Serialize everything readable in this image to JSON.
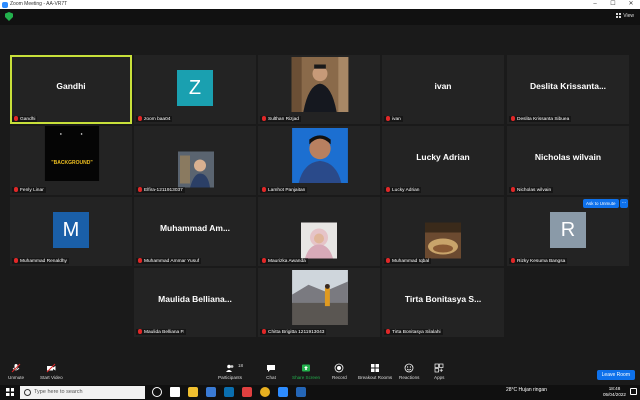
{
  "window": {
    "title": "Zoom Meeting - AA-VR7T",
    "minimize": "–",
    "maximize": "☐",
    "close": "✕"
  },
  "topbar": {
    "view_label": "View"
  },
  "tiles": [
    {
      "big_name": "Gandhi",
      "label": "Gandhi"
    },
    {
      "letter": "Z",
      "color": "#1aa0b0",
      "label": "zoom baa04"
    },
    {
      "label": "Sulthan Rizjad"
    },
    {
      "big_name": "ivan",
      "label": "ivan"
    },
    {
      "big_name": "Deslita Krissanta...",
      "label": "Deslita Krissanta Sibuea"
    },
    {
      "label": "Fenly Linar",
      "poster_text": "\"BACKGROUND\""
    },
    {
      "label": "Elfira-1211913037"
    },
    {
      "label": "Lamhot Panjaitan"
    },
    {
      "big_name": "Lucky Adrian",
      "label": "Lucky Adrian"
    },
    {
      "big_name": "Nicholas wilvain",
      "label": "Nicholas wilvain"
    },
    {
      "letter": "M",
      "color": "#1a5fa8",
      "label": "Muhammad Renaldhy"
    },
    {
      "big_name": "Muhammad  Am...",
      "label": "Muhammad Ammar Yusuf"
    },
    {
      "label": "Maurizka Awanda"
    },
    {
      "label": "Muhammad Iqbal"
    },
    {
      "letter": "R",
      "color": "#8a9aa8",
      "label": "Rizky Kesuma Bangsa"
    },
    {
      "big_name": "Maulida  Belliana...",
      "label": "Maulida Belliana P."
    },
    {
      "label": "Chitta Brigitta 1211913043"
    },
    {
      "big_name": "Tirta  Bonitasya  S...",
      "label": "Tirta Bonitasya Silalahi"
    }
  ],
  "ask_to_unmute": "Ask to Unmute",
  "more": "...",
  "toolbar": {
    "unmute": "Unmute",
    "start_video": "Start Video",
    "participants": "Participants",
    "participants_count": "18",
    "chat": "Chat",
    "share_screen": "Share Screen",
    "record": "Record",
    "breakout": "Breakout Rooms",
    "reactions": "Reactions",
    "apps": "Apps",
    "leave": "Leave Room"
  },
  "taskbar": {
    "search_placeholder": "Type here to search",
    "weather": "28°C  Hujan ringan",
    "time": "18:48",
    "date": "05/04/2022",
    "colors": {
      "accent": "#0e71eb",
      "active_border": "#c8e03a"
    }
  }
}
